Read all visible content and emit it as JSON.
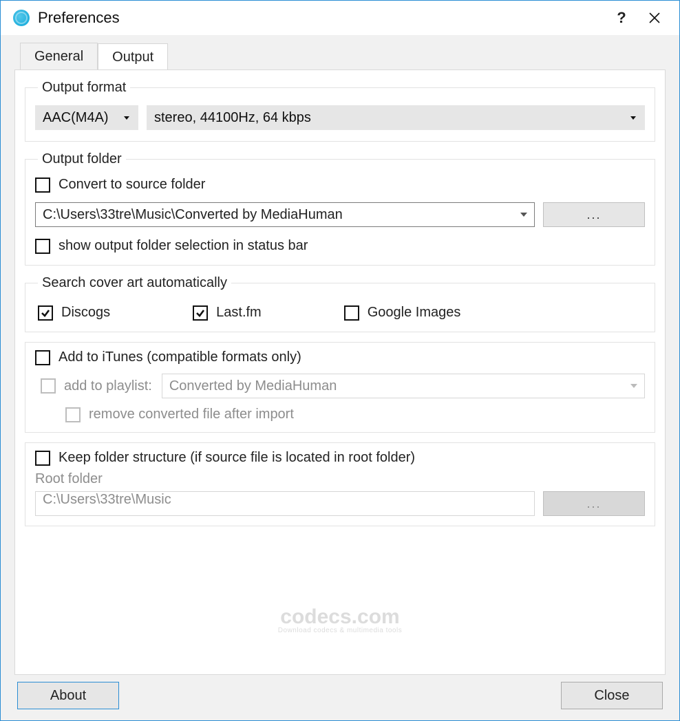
{
  "window": {
    "title": "Preferences"
  },
  "tabs": {
    "general": "General",
    "output": "Output"
  },
  "outputFormat": {
    "legend": "Output format",
    "codec": "AAC(M4A)",
    "params": "stereo, 44100Hz, 64 kbps"
  },
  "outputFolder": {
    "legend": "Output folder",
    "convertToSource": "Convert to source folder",
    "path": "C:\\Users\\33tre\\Music\\Converted by MediaHuman",
    "browse": "...",
    "showInStatusBar": "show output folder selection in status bar"
  },
  "coverArt": {
    "legend": "Search cover art automatically",
    "discogs": "Discogs",
    "lastfm": "Last.fm",
    "google": "Google Images"
  },
  "itunes": {
    "add": "Add to iTunes (compatible formats only)",
    "addToPlaylist": "add to playlist:",
    "playlist": "Converted by MediaHuman",
    "removeAfter": "remove converted file after import"
  },
  "keepFolder": {
    "label": "Keep folder structure (if source file is located in root folder)",
    "rootLabel": "Root folder",
    "rootPath": "C:\\Users\\33tre\\Music",
    "browse": "..."
  },
  "footer": {
    "about": "About",
    "close": "Close"
  },
  "watermark": {
    "main": "codecs.com",
    "sub": "Download codecs & multimedia tools"
  }
}
